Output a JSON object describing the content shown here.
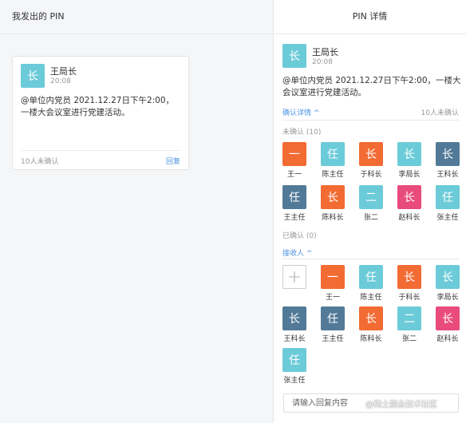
{
  "left": {
    "title": "我发出的 PIN",
    "card": {
      "avatar_char": "长",
      "name": "王局长",
      "time": "20:08",
      "content": "@单位内党员 2021.12.27日下午2:00，一楼大会议室进行党建活动。",
      "unconfirmed": "10人未确认",
      "reply": "回复"
    }
  },
  "right": {
    "title": "PIN 详情",
    "sender": {
      "avatar_char": "长",
      "name": "王局长",
      "time": "20:08"
    },
    "content": "@单位内党员 2021.12.27日下午2:00，一楼大会议室进行党建活动。",
    "confirm_detail_link": "确认详情 ^",
    "people_count": "10人未确认",
    "unconfirmed_label": "未确认 (10)",
    "confirmed_label": "已确认 (0)",
    "receivers_link": "接收人 ^",
    "reply_placeholder": "请输入回复内容",
    "watermark": "@稀土掘金技术社区"
  },
  "colors": {
    "orange": "#f26b33",
    "cyan": "#6ccbd8",
    "steel": "#527a98",
    "pink": "#e94b7c",
    "link": "#4a90e2"
  },
  "unconfirmed_members": [
    {
      "char": "一",
      "name": "王一",
      "color": "orange"
    },
    {
      "char": "任",
      "name": "陈主任",
      "color": "cyan"
    },
    {
      "char": "长",
      "name": "于科长",
      "color": "orange"
    },
    {
      "char": "长",
      "name": "李局长",
      "color": "cyan"
    },
    {
      "char": "长",
      "name": "王科长",
      "color": "steel"
    },
    {
      "char": "任",
      "name": "王主任",
      "color": "steel"
    },
    {
      "char": "长",
      "name": "陈科长",
      "color": "orange"
    },
    {
      "char": "二",
      "name": "张二",
      "color": "cyan"
    },
    {
      "char": "长",
      "name": "赵科长",
      "color": "pink"
    },
    {
      "char": "任",
      "name": "张主任",
      "color": "cyan"
    }
  ],
  "receivers": [
    {
      "char": "一",
      "name": "王一",
      "color": "orange"
    },
    {
      "char": "任",
      "name": "陈主任",
      "color": "cyan"
    },
    {
      "char": "长",
      "name": "于科长",
      "color": "orange"
    },
    {
      "char": "长",
      "name": "李局长",
      "color": "cyan"
    },
    {
      "char": "长",
      "name": "王科长",
      "color": "steel"
    },
    {
      "char": "任",
      "name": "王主任",
      "color": "steel"
    },
    {
      "char": "长",
      "name": "陈科长",
      "color": "orange"
    },
    {
      "char": "二",
      "name": "张二",
      "color": "cyan"
    },
    {
      "char": "长",
      "name": "赵科长",
      "color": "pink"
    },
    {
      "char": "任",
      "name": "张主任",
      "color": "cyan"
    }
  ]
}
